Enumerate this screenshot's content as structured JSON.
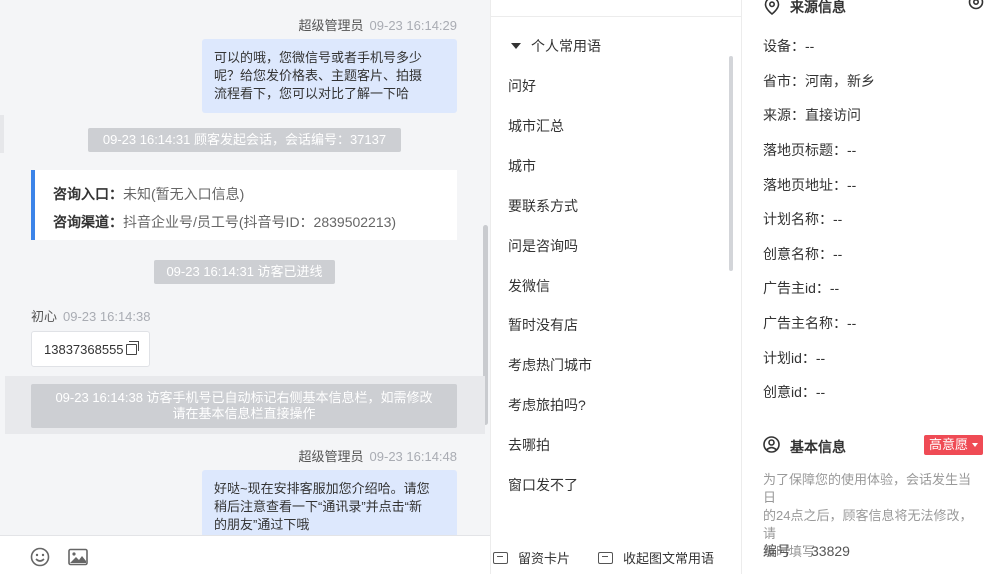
{
  "chat": {
    "msg1": {
      "sender": "超级管理员",
      "time": "09-23 16:14:29",
      "lines": [
        "可以的哦，您微信号或者手机号多少",
        "呢？给您发价格表、主题客片、拍摄",
        "流程看下，您可以对比了解一下哈"
      ]
    },
    "sys1": "09-23 16:14:31 顾客发起会话，会话编号：37137",
    "source_card": {
      "entry_label": "咨询入口：",
      "entry_value": "未知(暂无入口信息)",
      "channel_label": "咨询渠道：",
      "channel_value": "抖音企业号/员工号(抖音号ID：2839502213)"
    },
    "sys2": "09-23 16:14:31 访客已进线",
    "msg2": {
      "sender": "初心",
      "time": "09-23 16:14:38",
      "phone": "13837368555"
    },
    "sys3": [
      "09-23 16:14:38 访客手机号已自动标记右侧基本信息栏，如需修改",
      "请在基本信息栏直接操作"
    ],
    "msg3": {
      "sender": "超级管理员",
      "time": "09-23 16:14:48",
      "lines": [
        "好哒~现在安排客服加您介绍哈。请您",
        "稍后注意查看一下“通讯录”并点击“新",
        "的朋友”通过下哦"
      ]
    },
    "toolbar": {
      "emoji_icon": "emoji-icon",
      "image_icon": "image-icon"
    }
  },
  "phrases": {
    "group_title": "个人常用语",
    "items": [
      "问好",
      "城市汇总",
      "城市",
      "要联系方式",
      "问是咨询吗",
      "发微信",
      "暂时没有店",
      "考虑热门城市",
      "考虑旅拍吗?",
      "去哪拍",
      "窗口发不了"
    ],
    "footer": {
      "card_label": "留资卡片",
      "collapse_label": "收起图文常用语"
    }
  },
  "info": {
    "source_title": "来源信息",
    "source_rows": [
      "设备：--",
      "省市：河南，新乡",
      "来源：直接访问",
      "落地页标题：--",
      "落地页地址：--",
      "计划名称：--",
      "创意名称：--",
      "广告主id：--",
      "广告主名称：--",
      "计划id：--",
      "创意id：--"
    ],
    "basic_title": "基本信息",
    "intent_badge": "高意愿",
    "intent_color": "#ef4b55",
    "note_lines": [
      "为了保障您的使用体验，会话发生当日",
      "的24点之后，顾客信息将无法修改，请",
      "及时填写"
    ],
    "id_label": "编号",
    "id_value": "33829"
  }
}
